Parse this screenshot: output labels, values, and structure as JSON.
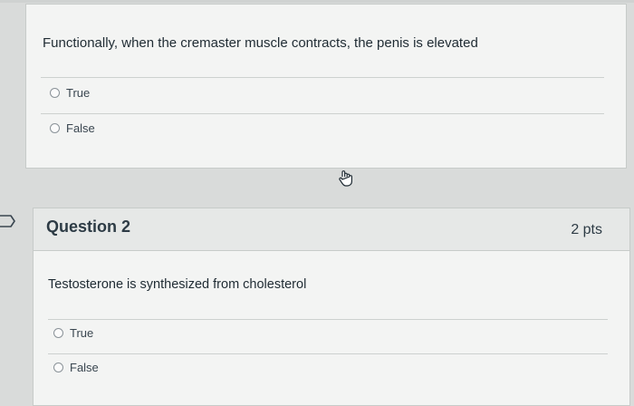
{
  "question1": {
    "text": "Functionally, when the cremaster muscle contracts, the penis is elevated",
    "answers": [
      "True",
      "False"
    ]
  },
  "question2": {
    "title": "Question 2",
    "points": "2 pts",
    "text": "Testosterone is synthesized from cholesterol",
    "answers": [
      "True",
      "False"
    ]
  },
  "icons": {
    "flag": "flag-outline-icon",
    "cursor": "hand-pointer-icon"
  },
  "colors": {
    "page_bg": "#d9dbda",
    "card_bg": "#f3f4f3",
    "header_bg": "#e6e8e7"
  }
}
